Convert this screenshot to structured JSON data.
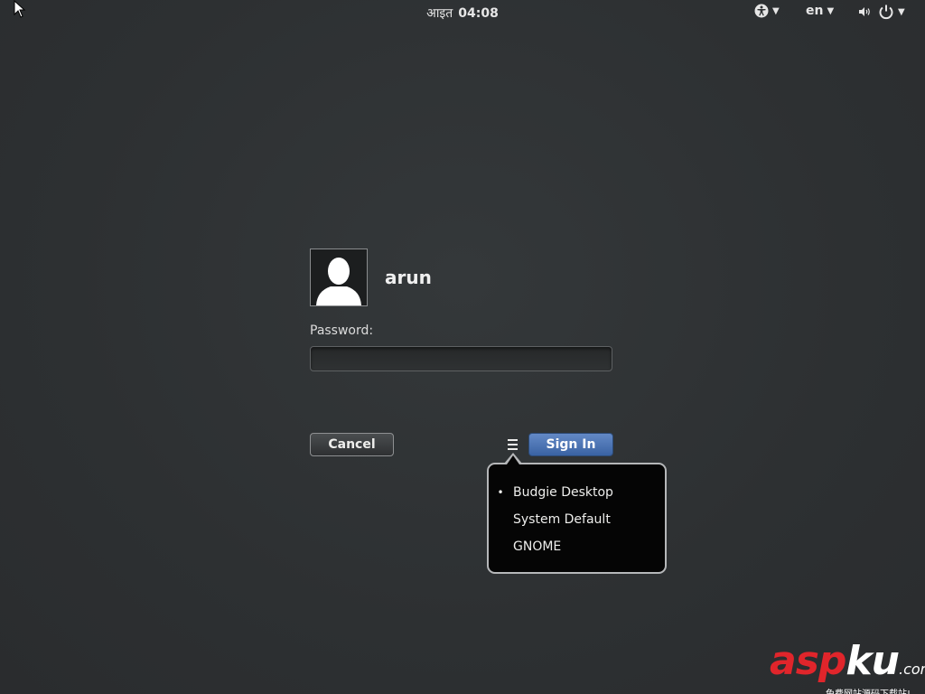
{
  "topbar": {
    "day": "आइत",
    "time": "04:08",
    "accessibility_icon": "accessibility-icon",
    "language": "en",
    "volume_icon": "volume-icon",
    "power_icon": "power-icon"
  },
  "login": {
    "username": "arun",
    "avatar_icon": "user-silhouette-icon",
    "password_label": "Password:",
    "password_value": "",
    "cancel_label": "Cancel",
    "session_icon": "hamburger-menu-icon",
    "signin_label": "Sign In"
  },
  "session_menu": {
    "selected_index": 0,
    "items": [
      {
        "label": "Budgie Desktop",
        "marker": "•"
      },
      {
        "label": "System Default",
        "marker": ""
      },
      {
        "label": "GNOME",
        "marker": ""
      }
    ]
  },
  "watermark": {
    "brand_a": "asp",
    "brand_b": "ku",
    "suffix": ".com",
    "tagline": "免费网站源码下载站!"
  },
  "colors": {
    "background": "#2e3133",
    "signin_blue": "#4a72b3",
    "watermark_red": "#e0252b"
  }
}
